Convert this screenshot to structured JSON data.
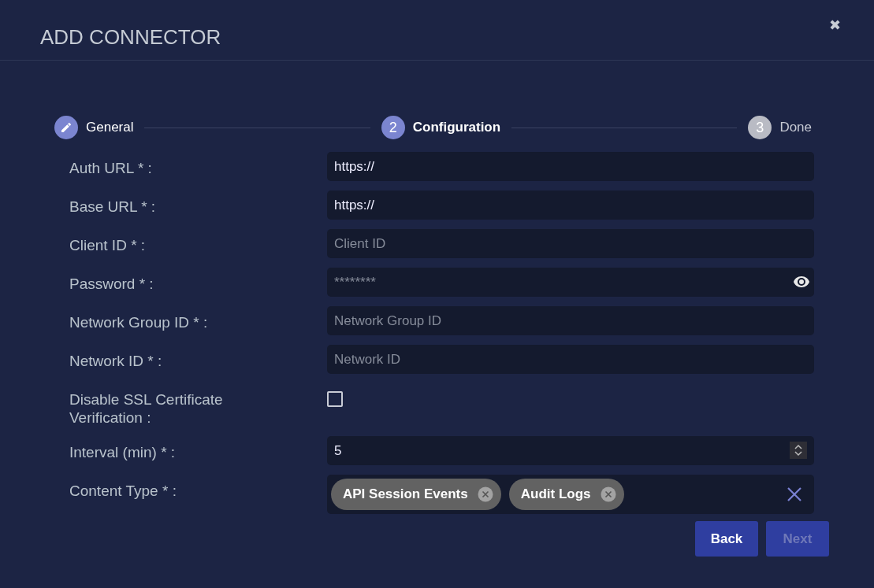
{
  "dialog": {
    "title": "ADD CONNECTOR",
    "close": "✖"
  },
  "steps": [
    {
      "label": "General",
      "completed": true,
      "selected": false
    },
    {
      "label": "Configuration",
      "number": "2",
      "completed": false,
      "selected": true
    },
    {
      "label": "Done",
      "number": "3",
      "completed": false,
      "selected": false
    }
  ],
  "fields": [
    {
      "kind": "text",
      "label": "Auth URL * :",
      "value": "https://"
    },
    {
      "kind": "text",
      "label": "Base URL * :",
      "value": "https://"
    },
    {
      "kind": "text",
      "label": "Client ID * :",
      "placeholder": "Client ID"
    },
    {
      "kind": "password",
      "label": "Password * :",
      "placeholder": "********"
    },
    {
      "kind": "text",
      "label": "Network Group ID * :",
      "placeholder": "Network Group ID"
    },
    {
      "kind": "text",
      "label": "Network ID * :",
      "placeholder": "Network ID"
    },
    {
      "kind": "checkbox",
      "label": "Disable SSL Certificate Verification  :",
      "checked": false
    },
    {
      "kind": "number",
      "label": "Interval (min) * :",
      "value": "5"
    },
    {
      "kind": "tags",
      "label": "Content Type * :",
      "tags": [
        "API Session Events",
        "Audit Logs"
      ]
    }
  ],
  "buttons": [
    {
      "label": "Back",
      "disabled": false
    },
    {
      "label": "Next",
      "disabled": true
    }
  ]
}
